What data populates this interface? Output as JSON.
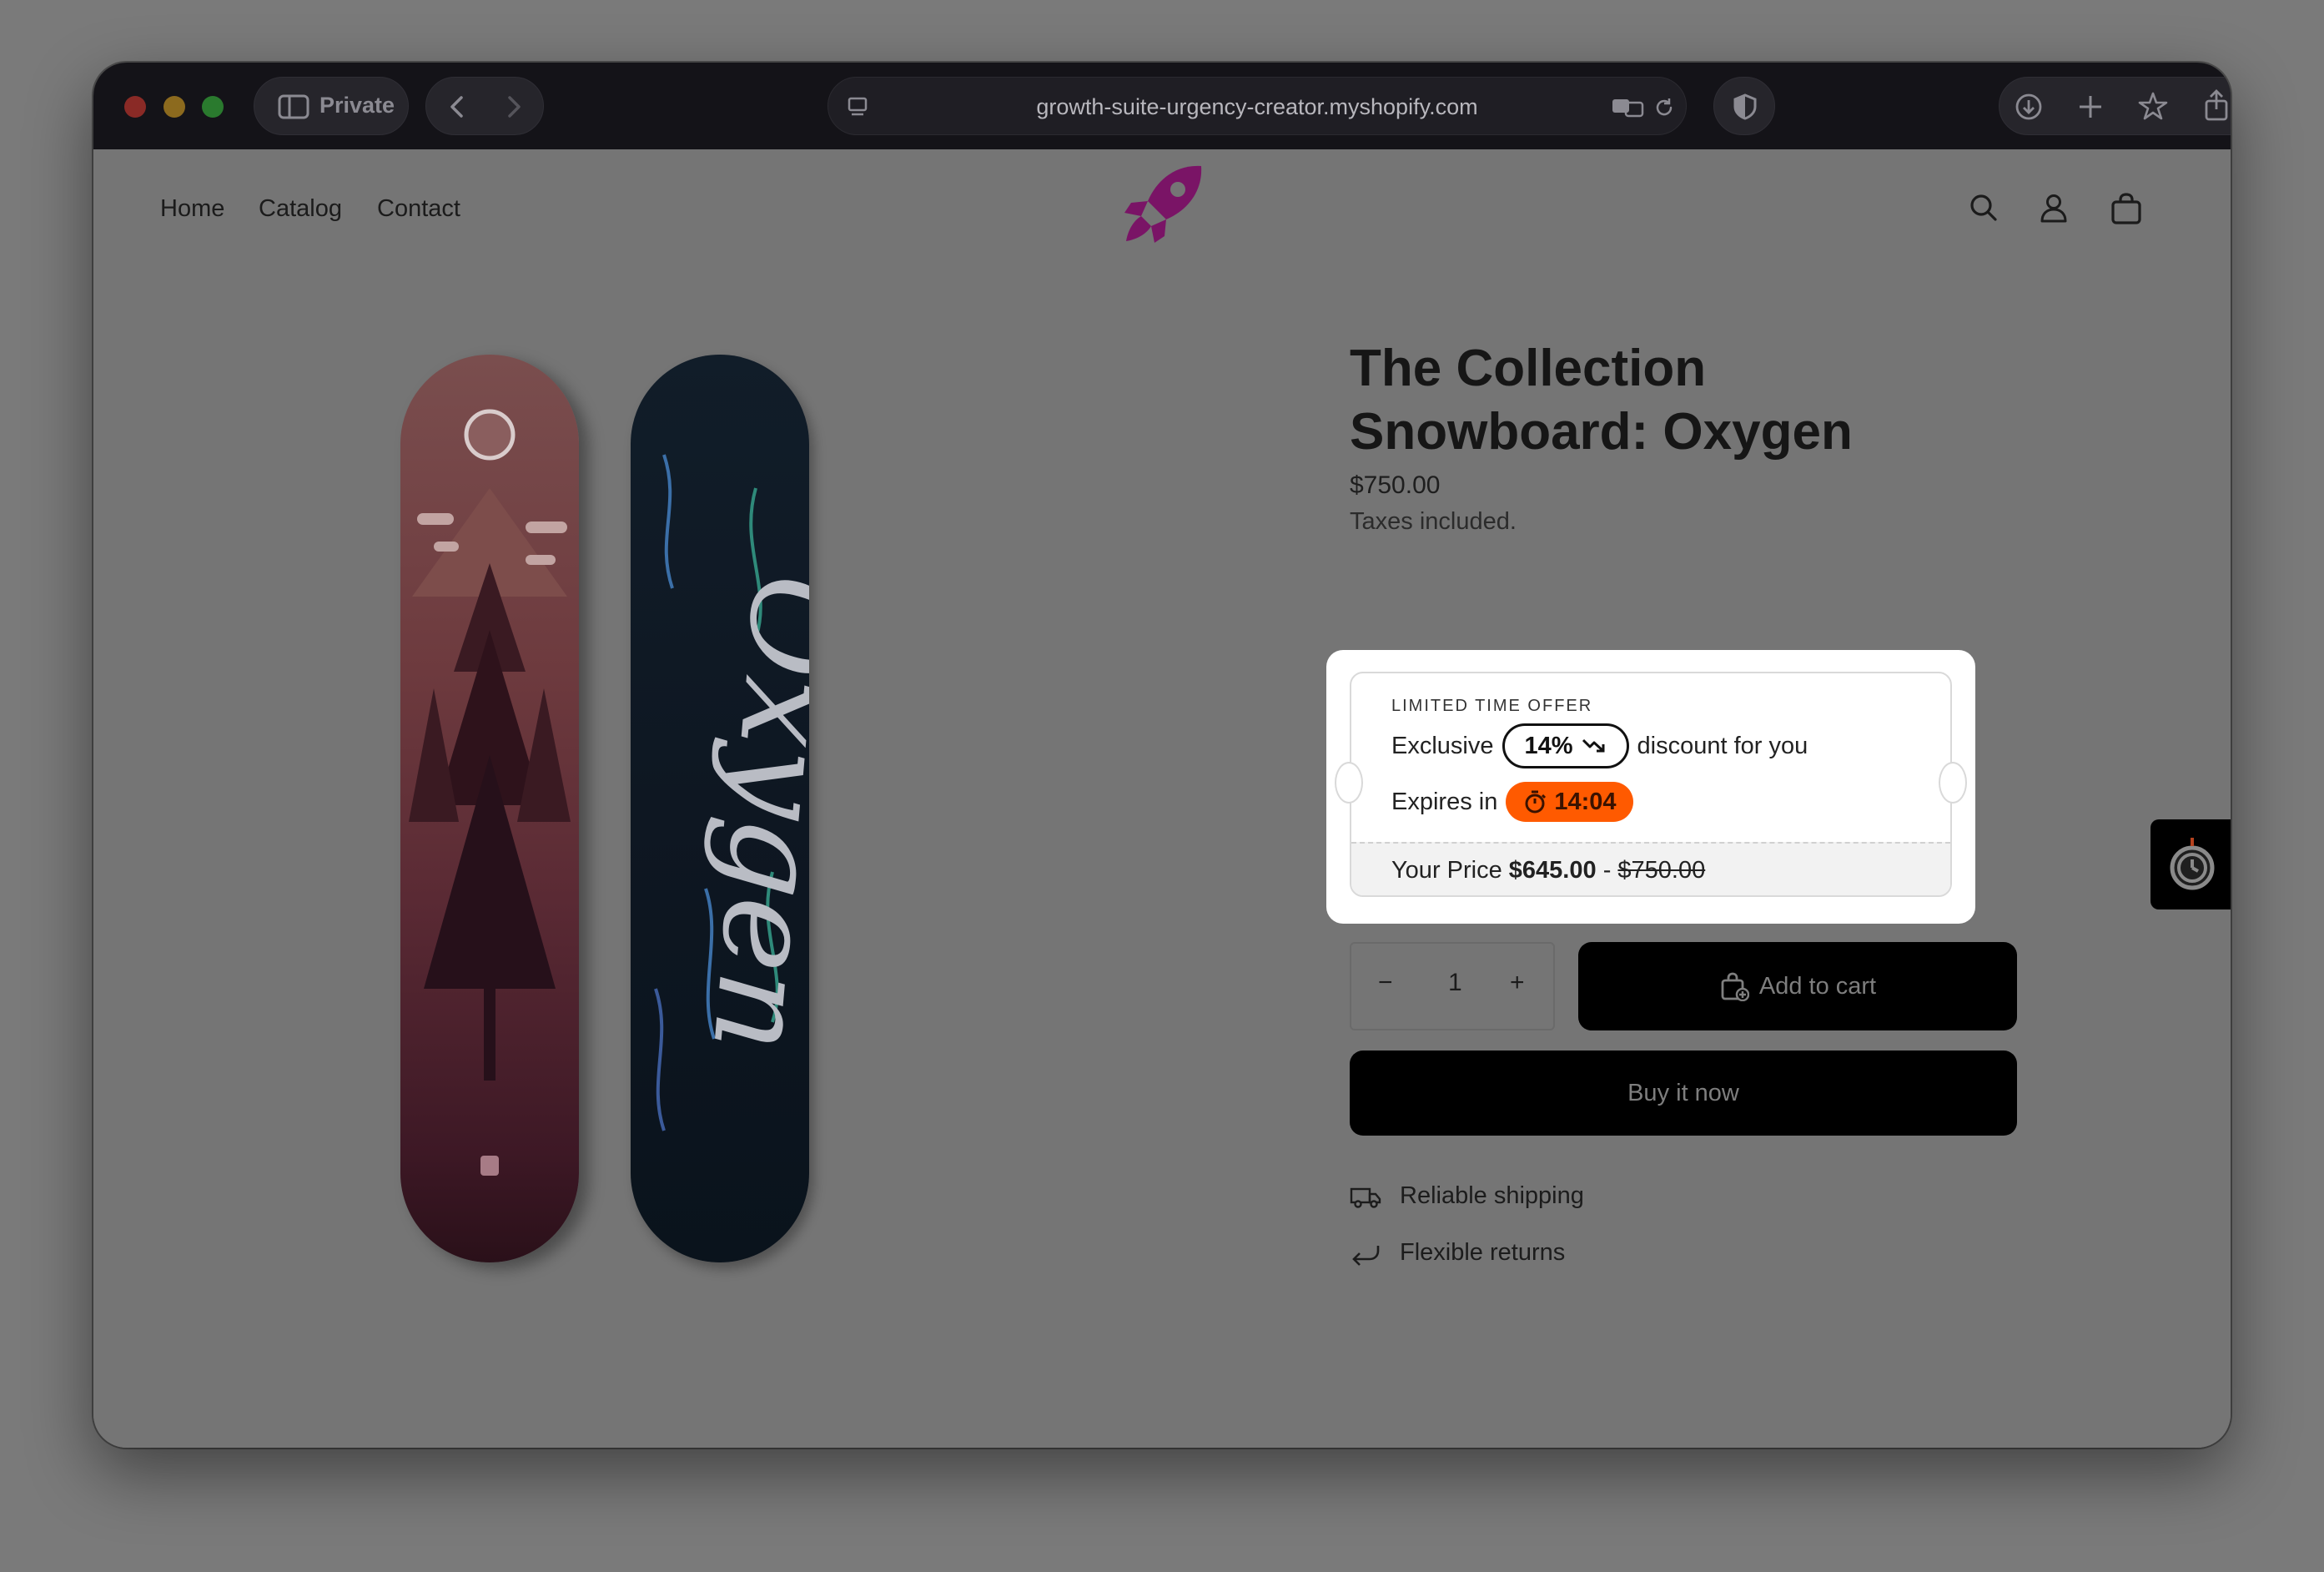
{
  "browser": {
    "private_label": "Private",
    "url": "growth-suite-urgency-creator.myshopify.com"
  },
  "nav": {
    "items": [
      "Home",
      "Catalog",
      "Contact"
    ]
  },
  "product": {
    "title": "The Collection Snowboard: Oxygen",
    "price": "$750.00",
    "tax_note": "Taxes included."
  },
  "offer": {
    "label": "LIMITED TIME OFFER",
    "prefix": "Exclusive",
    "discount": "14%",
    "suffix": "discount for you",
    "expires_label": "Expires in",
    "timer": "14:04",
    "your_price_label": "Your Price",
    "new_price": "$645.00",
    "separator": "-",
    "old_price": "$750.00"
  },
  "quantity": {
    "minus": "−",
    "value": "1",
    "plus": "+"
  },
  "buttons": {
    "add_to_cart": "Add to cart",
    "buy_now": "Buy it now"
  },
  "features": [
    "Reliable shipping",
    "Flexible returns"
  ],
  "board_text": "Oxygen",
  "colors": {
    "accent_timer": "#ff5a00",
    "logo": "#7a1466"
  }
}
